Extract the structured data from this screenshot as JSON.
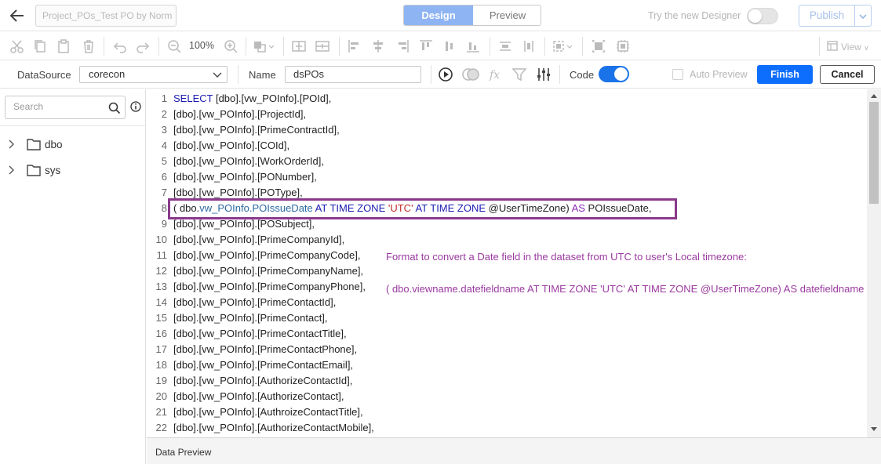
{
  "header": {
    "back_icon": "arrow-left-icon",
    "report_title": "Project_POs_Test PO by Norm",
    "tabs": {
      "design": "Design",
      "preview": "Preview"
    },
    "try_designer_label": "Try the new Designer",
    "publish_label": "Publish"
  },
  "toolbar": {
    "zoom": "100%",
    "view_label": "View",
    "icons": [
      "cut-icon",
      "copy-icon",
      "paste-icon",
      "delete-icon",
      "undo-icon",
      "redo-icon",
      "zoom-out-icon",
      "zoom-in-icon",
      "fill-icon",
      "align-icons"
    ]
  },
  "datasource_row": {
    "datasource_label": "DataSource",
    "datasource_value": "corecon",
    "name_label": "Name",
    "name_value": "dsPOs",
    "code_label": "Code",
    "code_enabled": true,
    "auto_preview_label": "Auto Preview",
    "finish_label": "Finish",
    "cancel_label": "Cancel"
  },
  "sidebar": {
    "search_placeholder": "Search",
    "items": [
      {
        "label": "dbo"
      },
      {
        "label": "sys"
      }
    ]
  },
  "editor": {
    "lines": [
      {
        "n": "1",
        "text": "SELECT [dbo].[vw_POInfo].[POId],"
      },
      {
        "n": "2",
        "text": "[dbo].[vw_POInfo].[ProjectId],"
      },
      {
        "n": "3",
        "text": "[dbo].[vw_POInfo].[PrimeContractId],"
      },
      {
        "n": "4",
        "text": "[dbo].[vw_POInfo].[COId],"
      },
      {
        "n": "5",
        "text": "[dbo].[vw_POInfo].[WorkOrderId],"
      },
      {
        "n": "6",
        "text": "[dbo].[vw_POInfo].[PONumber],"
      },
      {
        "n": "7",
        "text": "[dbo].[vw_POInfo].[POType],"
      },
      {
        "n": "8",
        "text": "( dbo.vw_POInfo.POIssueDate AT TIME ZONE 'UTC' AT TIME ZONE @UserTimeZone) AS POIssueDate,"
      },
      {
        "n": "9",
        "text": "[dbo].[vw_POInfo].[POSubject],"
      },
      {
        "n": "10",
        "text": "[dbo].[vw_POInfo].[PrimeCompanyId],"
      },
      {
        "n": "11",
        "text": "[dbo].[vw_POInfo].[PrimeCompanyCode],"
      },
      {
        "n": "12",
        "text": "[dbo].[vw_POInfo].[PrimeCompanyName],"
      },
      {
        "n": "13",
        "text": "[dbo].[vw_POInfo].[PrimeCompanyPhone],"
      },
      {
        "n": "14",
        "text": "[dbo].[vw_POInfo].[PrimeContactId],"
      },
      {
        "n": "15",
        "text": "[dbo].[vw_POInfo].[PrimeContact],"
      },
      {
        "n": "16",
        "text": "[dbo].[vw_POInfo].[PrimeContactTitle],"
      },
      {
        "n": "17",
        "text": "[dbo].[vw_POInfo].[PrimeContactPhone],"
      },
      {
        "n": "18",
        "text": "[dbo].[vw_POInfo].[PrimeContactEmail],"
      },
      {
        "n": "19",
        "text": "[dbo].[vw_POInfo].[AuthorizeContactId],"
      },
      {
        "n": "20",
        "text": "[dbo].[vw_POInfo].[AuthorizeContact],"
      },
      {
        "n": "21",
        "text": "[dbo].[vw_POInfo].[AuthroizeContactTitle],"
      },
      {
        "n": "22",
        "text": "[dbo].[vw_POInfo].[AuthorizeContactMobile],"
      }
    ],
    "annotation_title": "Format to convert a Date field in the dataset from UTC to user's Local timezone:",
    "annotation_format": "( dbo.viewname.datefieldname AT TIME ZONE 'UTC' AT TIME ZONE @UserTimeZone) AS datefieldname",
    "colors": {
      "keyword": "#1b1bb3",
      "alias": "#8b2bb8",
      "string": "#c22b2b",
      "highlight": "#8a3a8c",
      "annotation": "#9a3aa0"
    }
  },
  "footer": {
    "data_preview_label": "Data Preview"
  }
}
